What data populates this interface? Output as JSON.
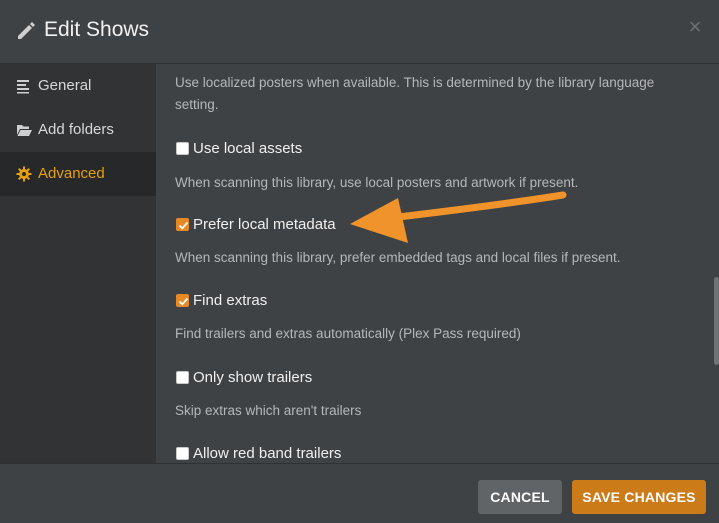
{
  "dialog": {
    "title": "Edit Shows",
    "close_label": "×"
  },
  "sidebar": {
    "items": [
      {
        "label": "General",
        "icon": "list-icon",
        "active": false
      },
      {
        "label": "Add folders",
        "icon": "folder-open-icon",
        "active": false
      },
      {
        "label": "Advanced",
        "icon": "gear-icon",
        "active": true
      }
    ]
  },
  "content": {
    "intro_text": "Use localized posters when available. This is determined by the library language setting.",
    "options": [
      {
        "label": "Use local assets",
        "checked": false,
        "description": "When scanning this library, use local posters and artwork if present."
      },
      {
        "label": "Prefer local metadata",
        "checked": true,
        "description": "When scanning this library, prefer embedded tags and local files if present."
      },
      {
        "label": "Find extras",
        "checked": true,
        "description": "Find trailers and extras automatically (Plex Pass required)"
      },
      {
        "label": "Only show trailers",
        "checked": false,
        "description": "Skip extras which aren't trailers"
      },
      {
        "label": "Allow red band trailers",
        "checked": false,
        "description": ""
      }
    ]
  },
  "footer": {
    "cancel_label": "CANCEL",
    "save_label": "SAVE CHANGES"
  },
  "colors": {
    "accent": "#e5a00d",
    "checkbox_checked": "#e88a23",
    "save_button": "#cc7b19",
    "cancel_button": "#616467",
    "annotation_arrow": "#f0932b"
  }
}
